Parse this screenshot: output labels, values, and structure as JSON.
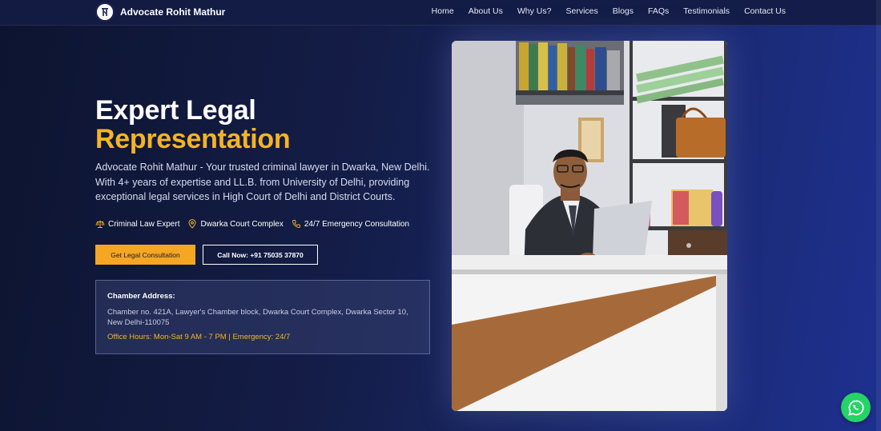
{
  "brand": {
    "name": "Advocate Rohit Mathur",
    "logo_icon": "justice-logo-icon"
  },
  "nav": {
    "items": [
      {
        "label": "Home"
      },
      {
        "label": "About Us"
      },
      {
        "label": "Why Us?"
      },
      {
        "label": "Services"
      },
      {
        "label": "Blogs"
      },
      {
        "label": "FAQs"
      },
      {
        "label": "Testimonials"
      },
      {
        "label": "Contact Us"
      }
    ]
  },
  "hero": {
    "title_line1": "Expert Legal",
    "title_line2": "Representation",
    "description": "Advocate Rohit Mathur - Your trusted criminal lawyer in Dwarka, New Delhi. With 4+ years of expertise and LL.B. from University of Delhi, providing exceptional legal services in High Court of Delhi and District Courts.",
    "badges": [
      {
        "icon": "scale-icon",
        "label": "Criminal Law Expert"
      },
      {
        "icon": "location-pin-icon",
        "label": "Dwarka Court Complex"
      },
      {
        "icon": "phone-icon",
        "label": "24/7 Emergency Consultation"
      }
    ],
    "primary_button": "Get Legal Consultation",
    "secondary_button": "Call Now: +91 75035 37870"
  },
  "address": {
    "title": "Chamber Address:",
    "text": "Chamber no. 421A, Lawyer's Chamber block, Dwarka Court Complex, Dwarka Sector 10, New Delhi-110075",
    "hours": "Office Hours: Mon-Sat 9 AM - 7 PM | Emergency: 24/7"
  },
  "colors": {
    "accent": "#f5b325",
    "button": "#f5a623",
    "whatsapp": "#25d366"
  }
}
